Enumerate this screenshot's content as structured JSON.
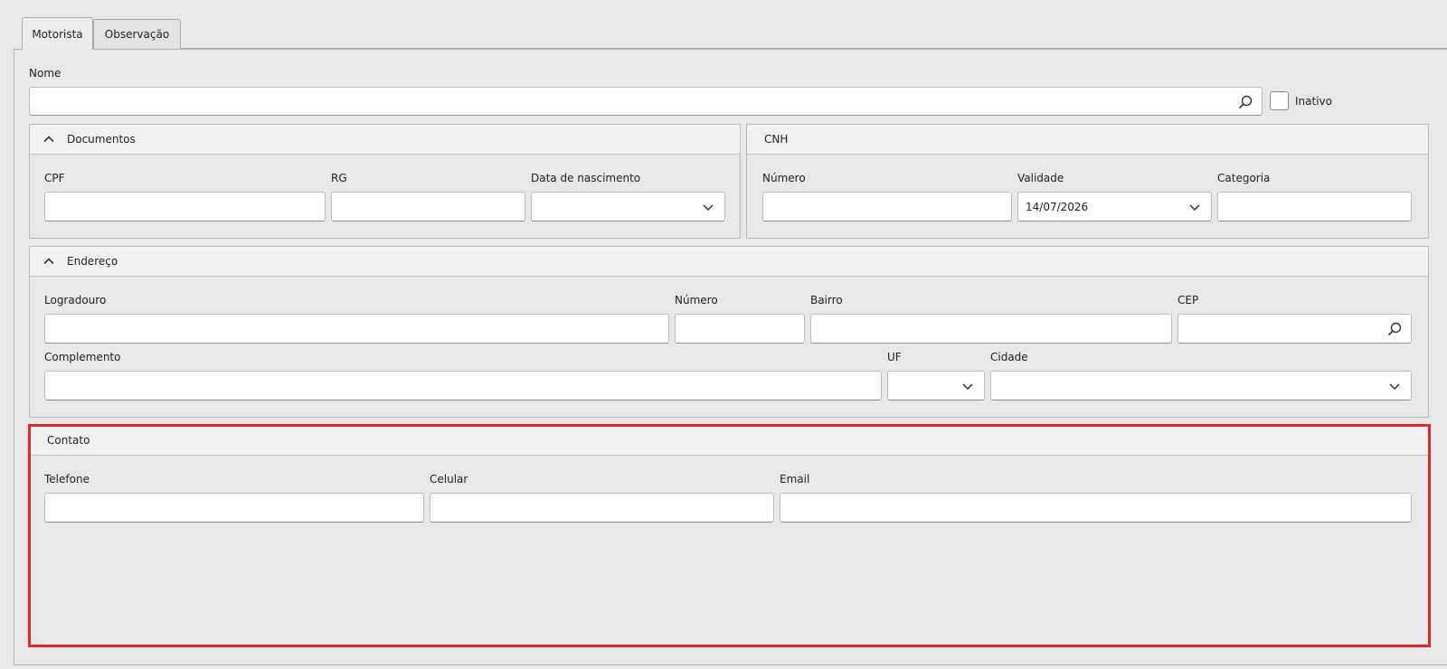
{
  "tabs": [
    {
      "label": "Motorista",
      "active": true
    },
    {
      "label": "Observação",
      "active": false
    }
  ],
  "nome": {
    "label": "Nome",
    "value": "",
    "icon": "search-icon"
  },
  "inativo": {
    "label": "Inativo",
    "checked": false
  },
  "documentos": {
    "title": "Documentos",
    "cpf_label": "CPF",
    "cpf_value": "",
    "rg_label": "RG",
    "rg_value": "",
    "nascimento_label": "Data de nascimento",
    "nascimento_value": ""
  },
  "cnh": {
    "title": "CNH",
    "numero_label": "Número",
    "numero_value": "",
    "validade_label": "Validade",
    "validade_value": "14/07/2026",
    "categoria_label": "Categoria",
    "categoria_value": ""
  },
  "endereco": {
    "title": "Endereço",
    "logradouro_label": "Logradouro",
    "logradouro_value": "",
    "numero_label": "Número",
    "numero_value": "",
    "bairro_label": "Bairro",
    "bairro_value": "",
    "cep_label": "CEP",
    "cep_value": "",
    "complemento_label": "Complemento",
    "complemento_value": "",
    "uf_label": "UF",
    "uf_value": "",
    "cidade_label": "Cidade",
    "cidade_value": ""
  },
  "contato": {
    "title": "Contato",
    "telefone_label": "Telefone",
    "telefone_value": "",
    "celular_label": "Celular",
    "celular_value": "",
    "email_label": "Email",
    "email_value": ""
  },
  "colors": {
    "highlight": "#e0282e",
    "panel_header": "#f2f2f2",
    "background": "#e8e8e8"
  }
}
